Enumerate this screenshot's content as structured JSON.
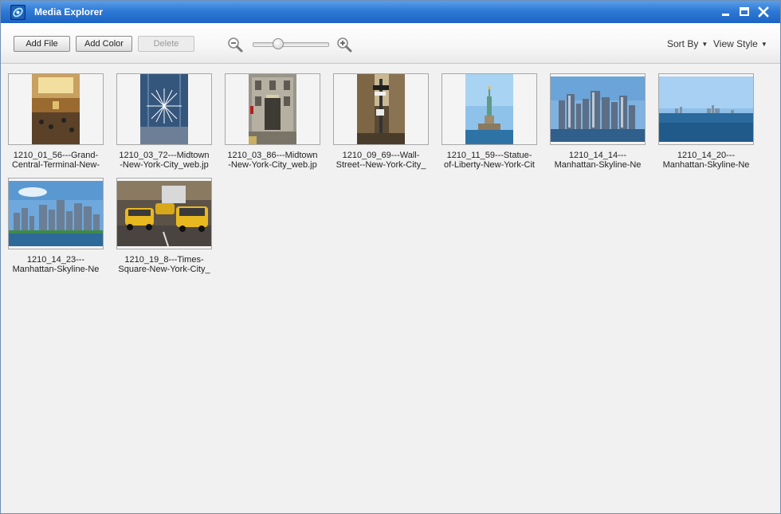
{
  "window": {
    "title": "Media Explorer"
  },
  "toolbar": {
    "add_file_label": "Add File",
    "add_color_label": "Add Color",
    "delete_label": "Delete",
    "sort_by_label": "Sort By",
    "view_style_label": "View Style",
    "zoom_level": 0.3
  },
  "icons": [
    "media-explorer-app-icon",
    "minimize-icon",
    "maximize-icon",
    "close-icon",
    "zoom-out-icon",
    "zoom-in-icon",
    "caret-down-icon"
  ],
  "colors": {
    "titlebar": "#2f7ad6",
    "title_text": "#ffffff",
    "background": "#f1f1f1"
  },
  "files": [
    {
      "line1": "1210_01_56---Grand-",
      "line2": "Central-Terminal-New-"
    },
    {
      "line1": "1210_03_72---Midtown",
      "line2": "-New-York-City_web.jp"
    },
    {
      "line1": "1210_03_86---Midtown",
      "line2": "-New-York-City_web.jp"
    },
    {
      "line1": "1210_09_69---Wall-",
      "line2": "Street--New-York-City_"
    },
    {
      "line1": "1210_11_59---Statue-",
      "line2": "of-Liberty-New-York-Cit"
    },
    {
      "line1": "1210_14_14---",
      "line2": "Manhattan-Skyline-Ne"
    },
    {
      "line1": "1210_14_20---",
      "line2": "Manhattan-Skyline-Ne"
    },
    {
      "line1": "1210_14_23---",
      "line2": "Manhattan-Skyline-Ne"
    },
    {
      "line1": "1210_19_8---Times-",
      "line2": "Square-New-York-City_"
    }
  ]
}
